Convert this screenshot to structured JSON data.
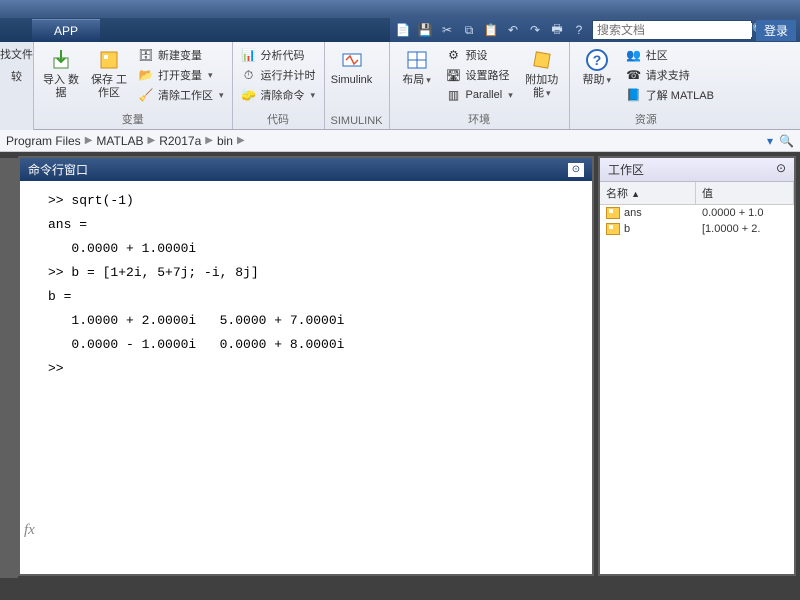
{
  "titlebar": {},
  "tabs": {
    "active": "APP"
  },
  "qat": {
    "icons": [
      "doc-icon",
      "save-icon",
      "cut-icon",
      "copy-icon",
      "paste-icon",
      "undo-icon",
      "redo-icon",
      "print-icon",
      "help-icon"
    ]
  },
  "search": {
    "placeholder": "搜索文档"
  },
  "login": "登录",
  "left_col": {
    "find": "找文件",
    "compare": "较"
  },
  "ribbon": {
    "variables": {
      "label": "变量",
      "import_data": "导入\n数据",
      "save_ws": "保存\n工作区",
      "new_var": "新建变量",
      "open_var": "打开变量",
      "clear_ws": "清除工作区"
    },
    "code": {
      "label": "代码",
      "analyze": "分析代码",
      "run_time": "运行并计时",
      "clear_cmd": "清除命令"
    },
    "simulink": {
      "label": "SIMULINK",
      "btn": "Simulink"
    },
    "environment": {
      "label": "环境",
      "layout": "布局",
      "prefs": "预设",
      "setpath": "设置路径",
      "parallel": "Parallel",
      "addons": "附加功能"
    },
    "resources": {
      "label": "资源",
      "help": "帮助",
      "community": "社区",
      "support": "请求支持",
      "learn": "了解 MATLAB"
    }
  },
  "address": {
    "parts": [
      "Program Files",
      "MATLAB",
      "R2017a",
      "bin"
    ]
  },
  "command_window": {
    "title": "命令行窗口",
    "lines": [
      ">> sqrt(-1)",
      "",
      "",
      "ans =",
      "",
      "   0.0000 + 1.0000i",
      "",
      "",
      ">> b = [1+2i, 5+7j; -i, 8j]",
      "",
      "",
      "b =",
      "",
      "   1.0000 + 2.0000i   5.0000 + 7.0000i",
      "   0.0000 - 1.0000i   0.0000 + 8.0000i",
      "",
      "",
      ">> "
    ],
    "fx": "fx"
  },
  "workspace": {
    "title": "工作区",
    "col_name": "名称",
    "col_value": "值",
    "rows": [
      {
        "name": "ans",
        "value": "0.0000 + 1.0"
      },
      {
        "name": "b",
        "value": "[1.0000 + 2."
      }
    ]
  }
}
